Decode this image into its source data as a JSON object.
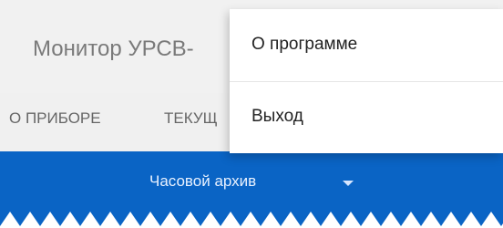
{
  "app": {
    "title": "Монитор УРСВ-"
  },
  "tabs": [
    {
      "label": "О ПРИБОРЕ"
    },
    {
      "label": "ТЕКУЩ"
    }
  ],
  "archive_selector": {
    "selected": "Часовой архив",
    "icon": "dropdown-arrow-icon"
  },
  "overflow_menu": {
    "items": [
      {
        "label": "О программе"
      },
      {
        "label": "Выход"
      }
    ]
  },
  "colors": {
    "primary": "#0a64c5",
    "app_bar": "#f1f1f1",
    "menu_bg": "#ffffff"
  }
}
